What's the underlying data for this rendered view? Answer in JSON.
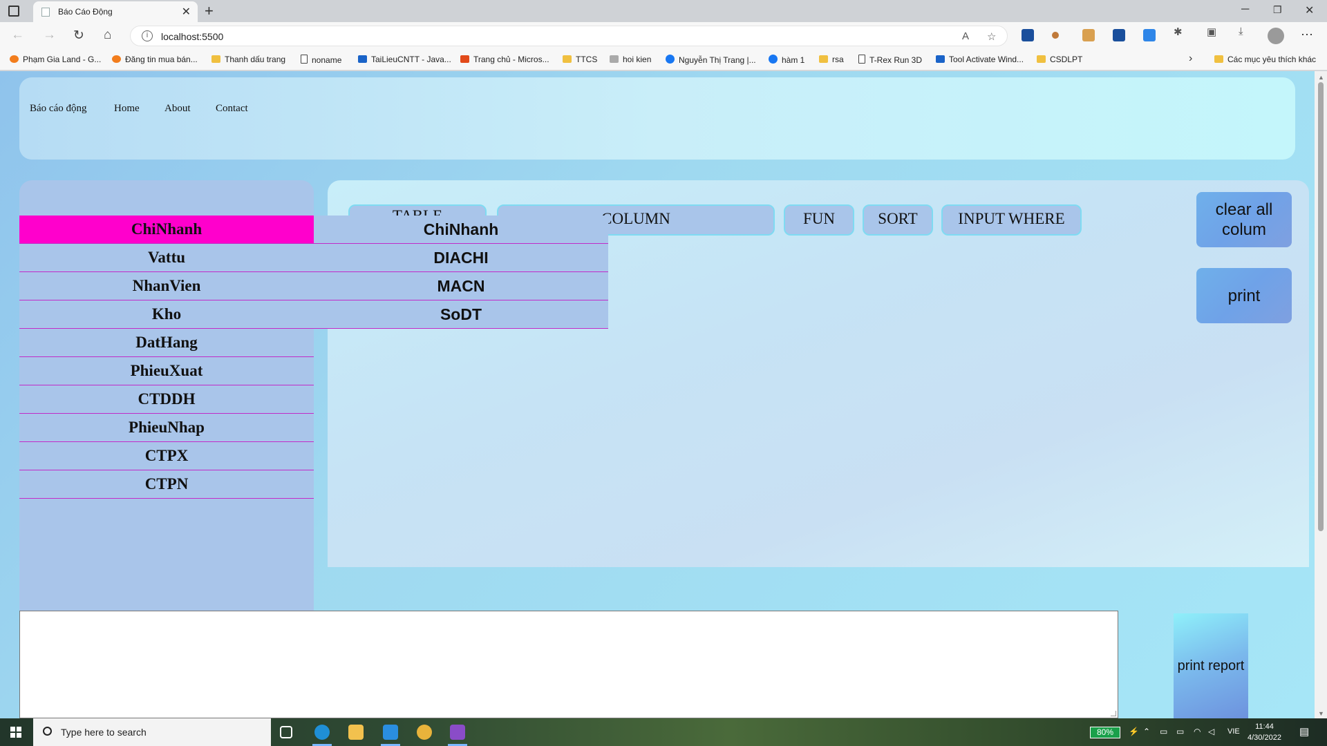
{
  "browser": {
    "tab_title": "Báo Cáo Động",
    "tab_close": "✕",
    "new_tab": "+",
    "url": "localhost:5500",
    "bookmarks": [
      {
        "label": "Phạm Gia Land - G...",
        "icon": "google-icon"
      },
      {
        "label": "Đăng tin mua bán...",
        "icon": "pin-icon"
      },
      {
        "label": "Thanh dấu trang",
        "icon": "folder-icon"
      },
      {
        "label": "noname",
        "icon": "page-icon"
      },
      {
        "label": "TaiLieuCNTT - Java...",
        "icon": "tailieu-icon"
      },
      {
        "label": "Trang chủ - Micros...",
        "icon": "office-icon"
      },
      {
        "label": "TTCS",
        "icon": "folder-icon"
      },
      {
        "label": "hoi kien",
        "icon": "site-icon"
      },
      {
        "label": "Nguyễn Thị Trang |...",
        "icon": "facebook-icon"
      },
      {
        "label": "hàm 1",
        "icon": "facebook-icon"
      },
      {
        "label": "rsa",
        "icon": "folder-icon"
      },
      {
        "label": "T-Rex Run 3D",
        "icon": "page-icon"
      },
      {
        "label": "Tool Activate Wind...",
        "icon": "doc-icon"
      },
      {
        "label": "CSDLPT",
        "icon": "folder-icon"
      }
    ],
    "other_bookmarks": "Các mục yêu thích khác"
  },
  "navbar": {
    "brand": "Báo cáo động",
    "links": [
      "Home",
      "About",
      "Contact"
    ]
  },
  "sidebar": {
    "items": [
      "ChiNhanh",
      "Vattu",
      "NhanVien",
      "Kho",
      "DatHang",
      "PhieuXuat",
      "CTDDH",
      "PhieuNhap",
      "CTPX",
      "CTPN"
    ],
    "active": "ChiNhanh",
    "active_color": "#ff00cc"
  },
  "tabs": [
    "TABLE",
    "COLUMN",
    "FUN",
    "SORT",
    "INPUT WHERE"
  ],
  "column_dropdown": [
    "ChiNhanh",
    "DIACHI",
    "MACN",
    "SoDT"
  ],
  "buttons": {
    "clear_all_line1": "clear all",
    "clear_all_line2": "colum",
    "print": "print",
    "print_report": "print report"
  },
  "taskbar": {
    "search_placeholder": "Type here to search",
    "battery": "80%",
    "language": "VIE",
    "time": "11:44",
    "date": "4/30/2022"
  }
}
